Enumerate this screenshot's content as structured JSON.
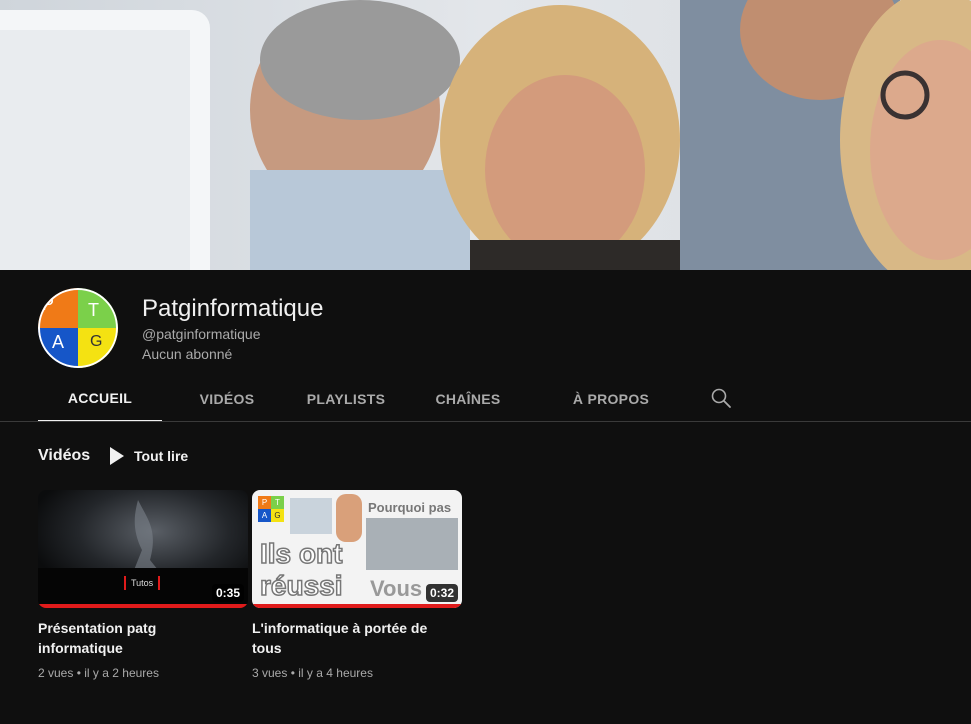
{
  "channel": {
    "name": "Patginformatique",
    "handle": "@patginformatique",
    "subscribers": "Aucun abonné",
    "avatar_letters": [
      "P",
      "T",
      "A",
      "G"
    ],
    "avatar_colors": [
      "#f07a17",
      "#7bd04a",
      "#1656c8",
      "#f4e212"
    ]
  },
  "tabs": [
    {
      "label": "ACCUEIL",
      "active": true
    },
    {
      "label": "VIDÉOS",
      "active": false
    },
    {
      "label": "PLAYLISTS",
      "active": false
    },
    {
      "label": "CHAÎNES",
      "active": false
    },
    {
      "label": "À PROPOS",
      "active": false
    }
  ],
  "search_icon": "search-icon",
  "section": {
    "title": "Vidéos",
    "play_all": "Tout lire"
  },
  "videos": [
    {
      "title": "Présentation patg informatique",
      "duration": "0:35",
      "views": "2 vues",
      "age": "il y a 2 heures",
      "thumb_caption": "Tutos",
      "watched": 1.0
    },
    {
      "title": "L'informatique à portée de tous",
      "duration": "0:32",
      "views": "3 vues",
      "age": "il y a 4 heures",
      "thumb_text": [
        "Pourquoi pas",
        "Ils ont",
        "réussi",
        "Vous"
      ],
      "thumb_letters": [
        "P",
        "T",
        "A",
        "G"
      ],
      "watched": 1.0
    }
  ],
  "colors": {
    "background": "#0f0f0f",
    "accent": "#e01b1b",
    "text": "#f1f1f1",
    "muted": "#aaaaaa"
  }
}
